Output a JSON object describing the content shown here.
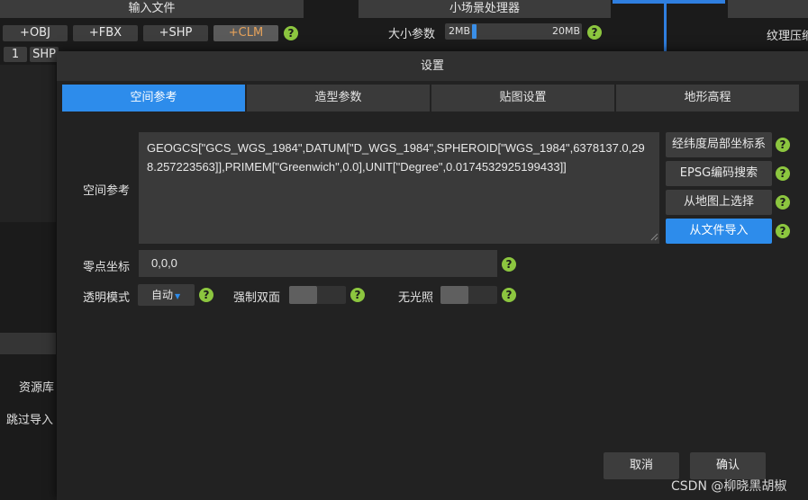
{
  "background": {
    "input_panel_title": "输入文件",
    "import_buttons": [
      "+OBJ",
      "+FBX",
      "+SHP",
      "+CLM"
    ],
    "file_row": {
      "index": "1",
      "type": "SHP"
    },
    "scene_panel_title": "小场景处理器",
    "size_label": "大小参数",
    "size_min": "2MB",
    "size_max": "20MB",
    "size_fraction": 0.05,
    "texture_label": "纹理压缩",
    "library_label": "资源库",
    "skip_label": "跳过导入",
    "help_glyph": "?"
  },
  "modal": {
    "title": "设置",
    "tabs": [
      {
        "label": "空间参考",
        "active": true
      },
      {
        "label": "造型参数",
        "active": false
      },
      {
        "label": "贴图设置",
        "active": false
      },
      {
        "label": "地形高程",
        "active": false
      }
    ],
    "spatial_ref_label": "空间参考",
    "spatial_ref_value": "GEOGCS[\"GCS_WGS_1984\",DATUM[\"D_WGS_1984\",SPHEROID[\"WGS_1984\",6378137.0,298.257223563]],PRIMEM[\"Greenwich\",0.0],UNIT[\"Degree\",0.0174532925199433]]",
    "side_buttons": [
      "经纬度局部坐标系",
      "EPSG编码搜索",
      "从地图上选择",
      "从文件导入"
    ],
    "origin_label": "零点坐标",
    "origin_value": "0,0,0",
    "transparency_label": "透明模式",
    "transparency_value": "自动",
    "double_side_label": "强制双面",
    "double_side_on": false,
    "unlit_label": "无光照",
    "unlit_on": false,
    "cancel_label": "取消",
    "confirm_label": "确认"
  },
  "watermark": "CSDN @柳晓黑胡椒",
  "colors": {
    "accent": "#2d8ceb",
    "help": "#8cc63f",
    "clm_text": "#e7a35a"
  }
}
